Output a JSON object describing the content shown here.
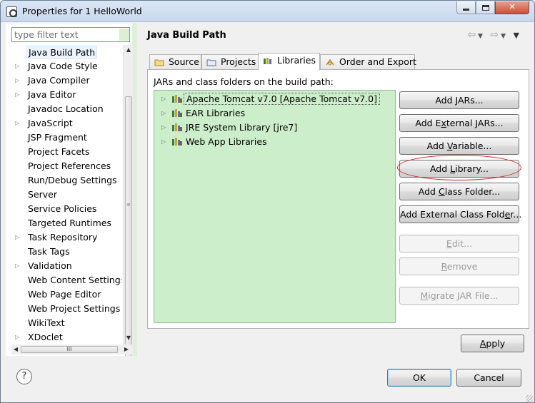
{
  "window": {
    "title": "Properties for 1 HelloWorld",
    "controls": {
      "minimize": "",
      "maximize": "",
      "close": "✕"
    }
  },
  "sidebar": {
    "filter_placeholder": "type filter text",
    "items": [
      {
        "label": "Java Build Path",
        "expandable": false,
        "selected": true
      },
      {
        "label": "Java Code Style",
        "expandable": true
      },
      {
        "label": "Java Compiler",
        "expandable": true
      },
      {
        "label": "Java Editor",
        "expandable": true
      },
      {
        "label": "Javadoc Location",
        "expandable": false
      },
      {
        "label": "JavaScript",
        "expandable": true
      },
      {
        "label": "JSP Fragment",
        "expandable": false
      },
      {
        "label": "Project Facets",
        "expandable": false
      },
      {
        "label": "Project References",
        "expandable": false
      },
      {
        "label": "Run/Debug Settings",
        "expandable": false
      },
      {
        "label": "Server",
        "expandable": false
      },
      {
        "label": "Service Policies",
        "expandable": false
      },
      {
        "label": "Targeted Runtimes",
        "expandable": false
      },
      {
        "label": "Task Repository",
        "expandable": true
      },
      {
        "label": "Task Tags",
        "expandable": false
      },
      {
        "label": "Validation",
        "expandable": true
      },
      {
        "label": "Web Content Settings",
        "expandable": false
      },
      {
        "label": "Web Page Editor",
        "expandable": false
      },
      {
        "label": "Web Project Settings",
        "expandable": false
      },
      {
        "label": "WikiText",
        "expandable": false
      },
      {
        "label": "XDoclet",
        "expandable": true
      }
    ],
    "hscroll_thumb": "III"
  },
  "main": {
    "title": "Java Build Path",
    "tabs": [
      {
        "label": "Source",
        "icon": "source-folder-icon"
      },
      {
        "label": "Projects",
        "icon": "projects-icon"
      },
      {
        "label": "Libraries",
        "icon": "libraries-icon",
        "active": true
      },
      {
        "label": "Order and Export",
        "icon": "order-export-icon"
      }
    ],
    "section_label": "JARs and class folders on the build path:",
    "libraries": [
      "Apache Tomcat v7.0 [Apache Tomcat v7.0]",
      "EAR Libraries",
      "JRE System Library [jre7]",
      "Web App Libraries"
    ],
    "buttons": {
      "add_jars": {
        "pre": "Add ",
        "u": "J",
        "post": "ARs..."
      },
      "add_external_jars": {
        "pre": "Add E",
        "u": "x",
        "post": "ternal JARs..."
      },
      "add_variable": {
        "pre": "Add ",
        "u": "V",
        "post": "ariable..."
      },
      "add_library": {
        "pre": "Add ",
        "u": "L",
        "post": "ibrary..."
      },
      "add_class_folder": {
        "pre": "Add ",
        "u": "C",
        "post": "lass Folder..."
      },
      "add_external_class_folder": {
        "pre": "Add External Class Fold",
        "u": "e",
        "post": "r..."
      },
      "edit": {
        "pre": "",
        "u": "E",
        "post": "dit..."
      },
      "remove": {
        "pre": "",
        "u": "R",
        "post": "emove"
      },
      "migrate_jar": {
        "pre": "",
        "u": "M",
        "post": "igrate JAR File..."
      }
    },
    "apply": {
      "pre": "",
      "u": "A",
      "post": "pply"
    }
  },
  "footer": {
    "help": "?",
    "ok": "OK",
    "cancel": "Cancel"
  },
  "colors": {
    "library_list_bg": "#cdeeca",
    "highlight_oval": "#cc2020",
    "default_button_border": "#3c7fb1"
  }
}
